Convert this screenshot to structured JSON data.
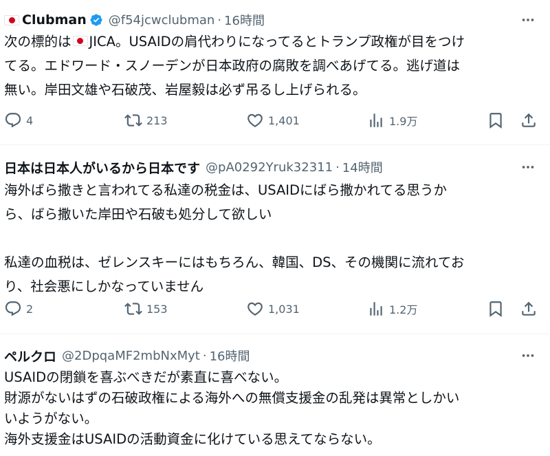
{
  "tweets": [
    {
      "name": "Clubman",
      "handle": "@f54jcwclubman",
      "dot": "·",
      "time": "16時間",
      "lines": [
        {
          "before": "次の標的は",
          "after": "JICA。USAIDの肩代わりになってるとトランプ政権が目をつけ"
        },
        {
          "text": "てる。エドワード・スノーデンが日本政府の腐敗を調べあげてる。逃げ道は"
        },
        {
          "text": "無い。岸田文雄や石破茂、岩屋毅は必ず吊るし上げられる。"
        }
      ],
      "replies": "4",
      "retweets": "213",
      "likes": "1,401",
      "views": "1.9万"
    },
    {
      "name": "日本は日本人がいるから日本です",
      "handle": "@pA0292Yruk32311",
      "dot": "·",
      "time": "14時間",
      "lines": [
        "海外ばら撒きと言われてる私達の税金は、USAIDにばら撒かれてる思うか",
        "ら、ばら撒いた岸田や石破も処分して欲しい",
        "",
        "私達の血税は、ゼレンスキーにはもちろん、韓国、DS、その機関に流れてお",
        "り、社会悪にしかなっていません"
      ],
      "replies": "2",
      "retweets": "153",
      "likes": "1,031",
      "views": "1.2万"
    },
    {
      "name": "ペルクロ",
      "handle": "@2DpqaMF2mbNxMyt",
      "dot": "·",
      "time": "16時間",
      "lines": [
        "USAIDの閉鎖を喜ぶべきだが素直に喜べない。",
        "財源がないはずの石破政権による海外への無償支援金の乱発は異常としかい",
        "いようがない。",
        "海外支援金はUSAIDの活動資金に化けている思えてならない。"
      ]
    }
  ],
  "colors": {
    "text": "#0f1419",
    "secondary": "#536471",
    "verified": "#1d9bf0",
    "flag_red": "#d5001c",
    "divider": "#eff3f4"
  },
  "icons": [
    "more-icon",
    "verified-badge-icon",
    "japan-flag-icon",
    "reply-icon",
    "retweet-icon",
    "like-icon",
    "views-icon",
    "bookmark-icon",
    "share-icon"
  ]
}
